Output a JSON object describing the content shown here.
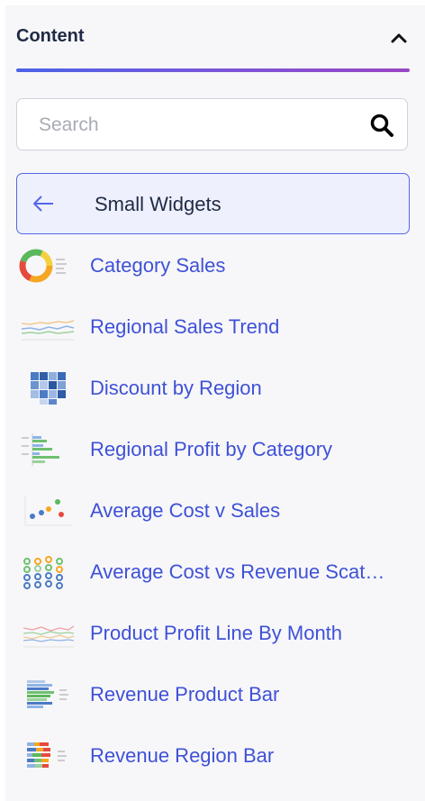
{
  "panel": {
    "title": "Content",
    "collapse_icon": "chevron-up-icon"
  },
  "search": {
    "placeholder": "Search",
    "icon": "search-icon"
  },
  "back": {
    "label": "Small Widgets",
    "icon": "arrow-left-icon"
  },
  "items": [
    {
      "label": "Category Sales",
      "thumbnail": "donut-chart-thumbnail"
    },
    {
      "label": "Regional Sales Trend",
      "thumbnail": "line-chart-thumbnail"
    },
    {
      "label": "Discount by Region",
      "thumbnail": "heatmap-thumbnail"
    },
    {
      "label": "Regional Profit by Category",
      "thumbnail": "horizontal-bar-thumbnail"
    },
    {
      "label": "Average Cost v Sales",
      "thumbnail": "scatter-thumbnail"
    },
    {
      "label": "Average Cost vs Revenue Scat…",
      "thumbnail": "bubble-grid-thumbnail"
    },
    {
      "label": "Product Profit Line By Month",
      "thumbnail": "multi-line-thumbnail"
    },
    {
      "label": "Revenue Product Bar",
      "thumbnail": "stacked-bar-thumbnail"
    },
    {
      "label": "Revenue Region Bar",
      "thumbnail": "stacked-bar-colored-thumbnail"
    }
  ],
  "colors": {
    "accent": "#4b63e6",
    "link": "#3f51d6",
    "title": "#1f2a44"
  }
}
